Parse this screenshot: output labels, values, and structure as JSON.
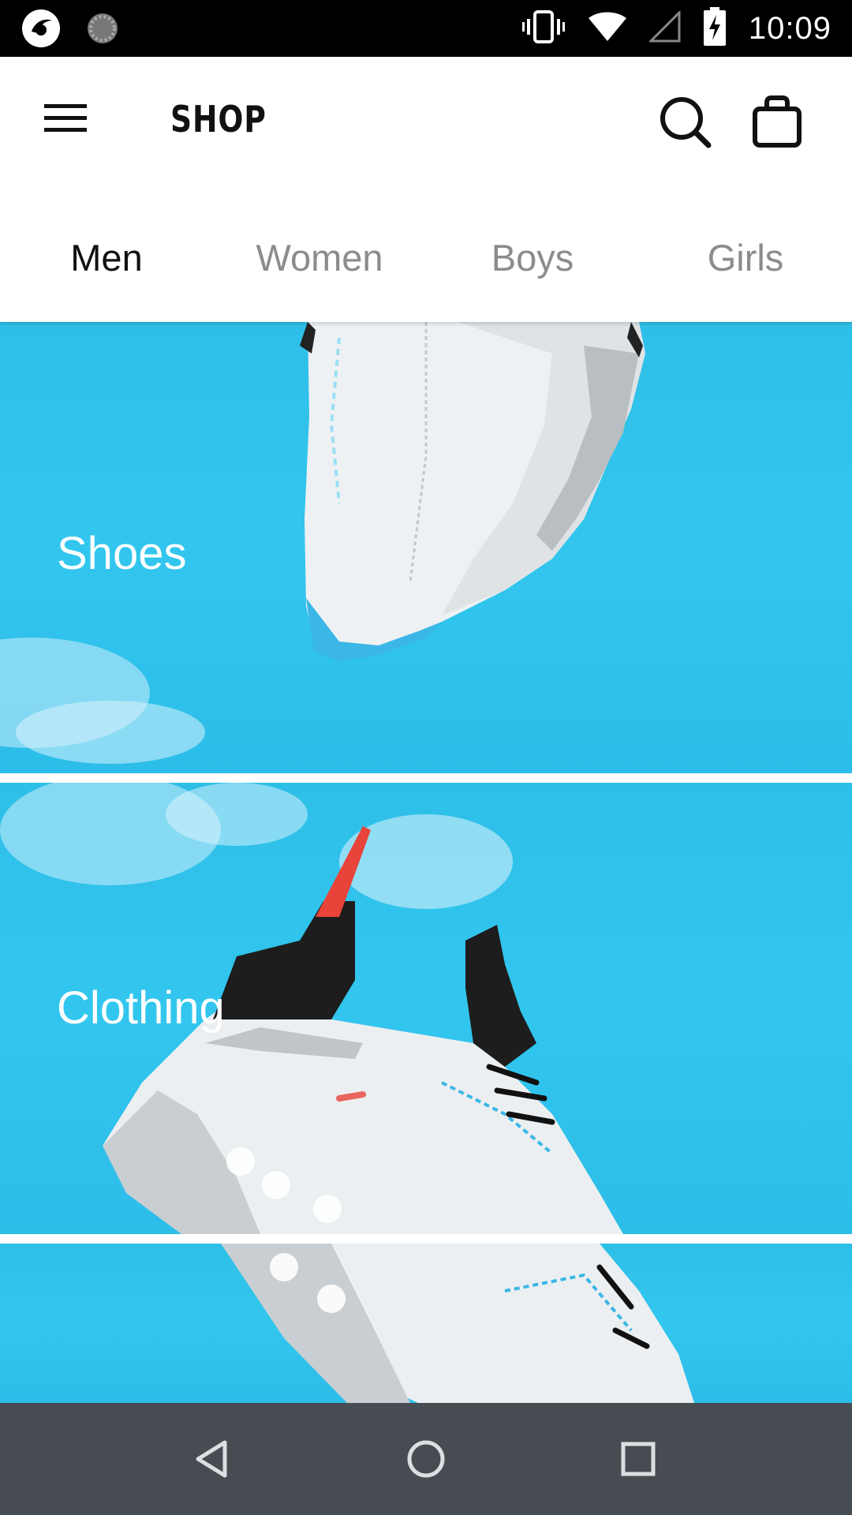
{
  "status_bar": {
    "time": "10:09",
    "icons": [
      "app-notification-icon",
      "loading-icon",
      "vibrate-icon",
      "wifi-icon",
      "cell-signal-icon",
      "battery-charging-icon"
    ]
  },
  "app_bar": {
    "title": "SHOP",
    "icons": [
      "menu-icon",
      "search-icon",
      "shopping-bag-icon"
    ]
  },
  "tabs": [
    {
      "label": "Men",
      "active": true
    },
    {
      "label": "Women",
      "active": false
    },
    {
      "label": "Boys",
      "active": false
    },
    {
      "label": "Girls",
      "active": false
    }
  ],
  "categories": [
    {
      "label": "Shoes"
    },
    {
      "label": "Clothing"
    }
  ],
  "nav_bar": {
    "icons": [
      "back-icon",
      "home-icon",
      "recents-icon"
    ]
  },
  "colors": {
    "sky": "#31c3ec",
    "status_bar": "#000000",
    "nav_bar": "#474c52",
    "tab_active": "#111111",
    "tab_inactive": "#8c8c8c"
  }
}
